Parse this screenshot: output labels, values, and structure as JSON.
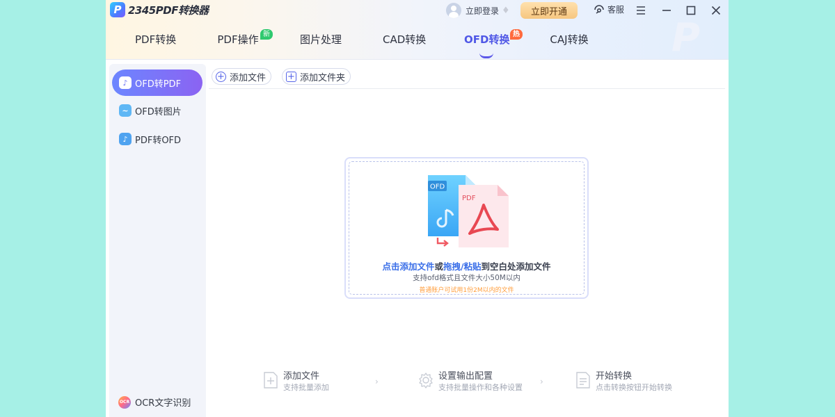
{
  "app": {
    "logo_mark": "P",
    "logo_text": "2345PDF转换器"
  },
  "header": {
    "login_text": "立即登录",
    "vip_button": "立即开通",
    "service": "客服"
  },
  "tabs": [
    {
      "label": "PDF转换",
      "tag": ""
    },
    {
      "label": "PDF操作",
      "tag": "新"
    },
    {
      "label": "图片处理",
      "tag": ""
    },
    {
      "label": "CAD转换",
      "tag": ""
    },
    {
      "label": "OFD转换",
      "tag": "热",
      "active": true
    },
    {
      "label": "CAJ转换",
      "tag": ""
    }
  ],
  "sidebar": {
    "items": [
      {
        "label": "OFD转PDF",
        "active": true
      },
      {
        "label": "OFD转图片"
      },
      {
        "label": "PDF转OFD"
      }
    ],
    "ocr_badge": "OCR",
    "ocr_label": "OCR文字识别"
  },
  "toolbar": {
    "add_file": "添加文件",
    "add_folder": "添加文件夹"
  },
  "dropzone": {
    "ofd_label": "OFD",
    "pdf_label": "PDF",
    "click_add": "点击添加文件",
    "or": "或",
    "drag_paste": "拖拽/粘贴",
    "to_blank": "到空白处添加文件",
    "support": "支持ofd格式且文件大小50M以内",
    "note": "普通账户可试用1份2M以内的文件"
  },
  "steps": [
    {
      "title": "添加文件",
      "desc": "支持批量添加"
    },
    {
      "title": "设置输出配置",
      "desc": "支持批量操作和各种设置"
    },
    {
      "title": "开始转换",
      "desc": "点击转换按钮开始转换"
    }
  ],
  "colors": {
    "accent": "#4f57e6",
    "link": "#3b6fe8",
    "note": "#ff9e3d",
    "tag_new": "#2fc96f",
    "tag_hot": "#ff6a3d"
  }
}
